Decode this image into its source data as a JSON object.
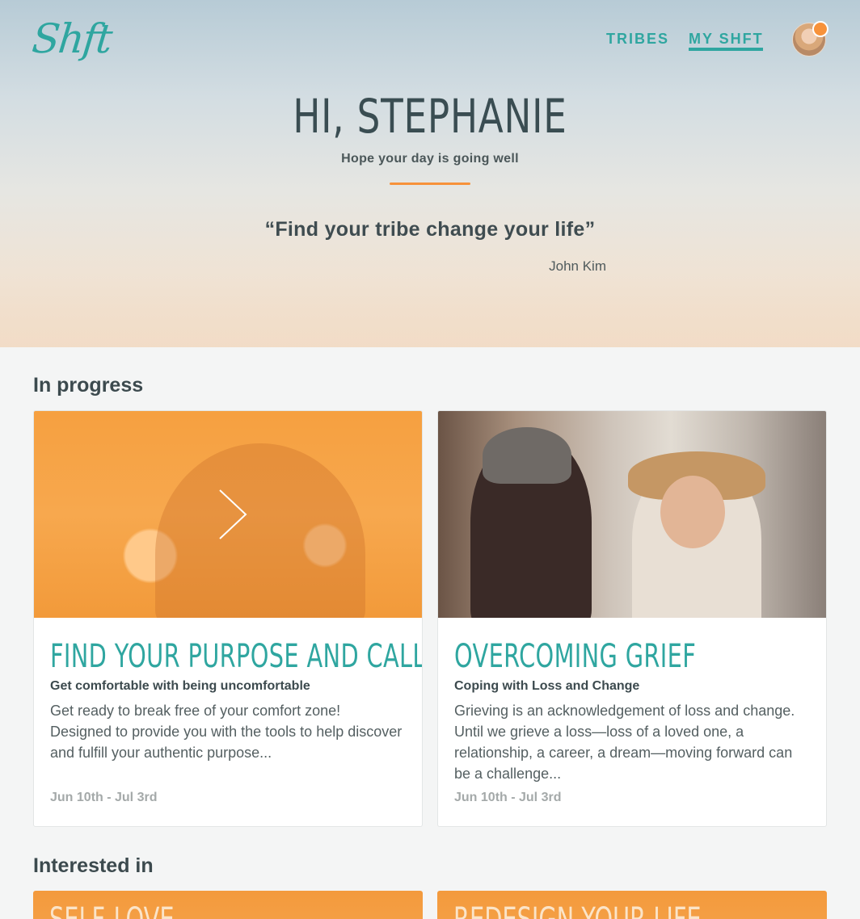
{
  "header": {
    "logo_text": "Shft",
    "nav": {
      "tribes": "TRIBES",
      "my_shft": "MY SHFT"
    },
    "avatar_badge_color": "#f7923a"
  },
  "hero": {
    "greeting": "HI, STEPHANIE",
    "subtitle": "Hope your day is going well",
    "quote": "“Find your tribe change your life”",
    "author": "John Kim"
  },
  "in_progress": {
    "title": "In progress",
    "cards": [
      {
        "title": "FIND YOUR PURPOSE AND CALLING",
        "subtitle": "Get comfortable with being uncomfortable",
        "description": "Get ready to break free of your comfort zone! Designed to provide you with the tools to help discover and fulfill your authentic purpose...",
        "dates": "Jun 10th - Jul 3rd"
      },
      {
        "title": "OVERCOMING GRIEF",
        "subtitle": "Coping with Loss and Change",
        "description": "Grieving is an acknowledgement of loss and change. Until we grieve a loss—loss of a loved one, a relationship, a career, a dream—moving forward can be a challenge...",
        "dates": "Jun 10th - Jul 3rd"
      }
    ]
  },
  "interested_in": {
    "title": "Interested in",
    "cards": [
      {
        "title": "SELF-LOVE"
      },
      {
        "title": "REDESIGN YOUR LIFE"
      }
    ]
  },
  "colors": {
    "accent": "#2fa6a0",
    "orange": "#f7923a",
    "text": "#3c4a4e"
  }
}
